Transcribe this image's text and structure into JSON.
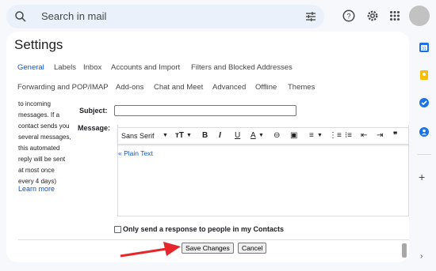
{
  "topbar": {
    "search_placeholder": "Search in mail",
    "icons": [
      "search-icon",
      "tune-icon",
      "help-icon",
      "settings-icon",
      "apps-icon",
      "avatar"
    ]
  },
  "settings": {
    "title": "Settings",
    "tabs_row1": [
      "General",
      "Labels",
      "Inbox",
      "Accounts and Import",
      "Filters and Blocked Addresses"
    ],
    "tabs_row2": [
      "Forwarding and POP/IMAP",
      "Add-ons",
      "Chat and Meet",
      "Advanced",
      "Offline",
      "Themes"
    ],
    "active_tab": "General"
  },
  "vacation": {
    "help_lines": [
      "to incoming",
      "messages. If a",
      "contact sends you",
      "several messages,",
      "this automated",
      "reply will be sent",
      "at most once",
      "every 4 days)"
    ],
    "learn_more": "Learn more",
    "subject_label": "Subject:",
    "subject_value": "",
    "message_label": "Message:",
    "font_name": "Sans Serif",
    "plain_text_link": "« Plain Text",
    "contacts_only_label": "Only send a response to people in my Contacts"
  },
  "actions": {
    "save": "Save Changes",
    "cancel": "Cancel"
  },
  "colors": {
    "accent": "#0b57d0",
    "annotation_arrow": "#e5262a"
  }
}
